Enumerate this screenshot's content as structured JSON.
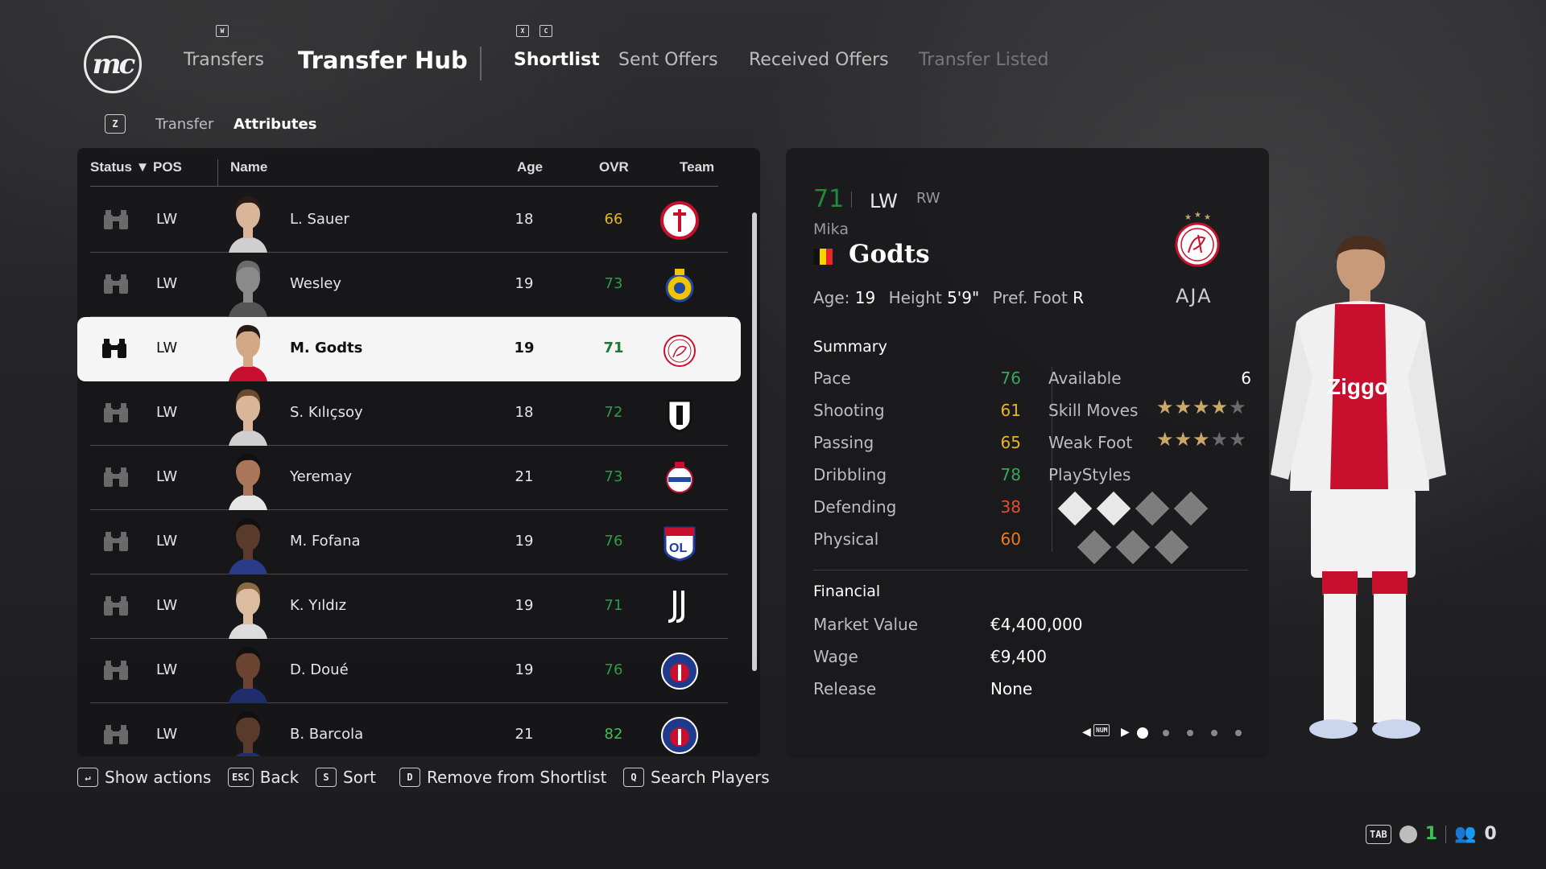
{
  "header": {
    "logo_text": "mc",
    "key_w": "W",
    "key_x": "X",
    "key_c": "C",
    "nav_transfers": "Transfers",
    "title": "Transfer Hub",
    "tabs": [
      "Shortlist",
      "Sent Offers",
      "Received Offers",
      "Transfer Listed"
    ],
    "active_tab": "Shortlist"
  },
  "subtabs": {
    "key": "Z",
    "items": [
      "Transfer",
      "Attributes"
    ],
    "active": "Attributes"
  },
  "table": {
    "columns": {
      "status": "Status ▼",
      "pos": "POS",
      "name": "Name",
      "age": "Age",
      "ovr": "OVR",
      "team": "Team"
    },
    "rows": [
      {
        "pos": "LW",
        "name": "L. Sauer",
        "age": "18",
        "ovr": "66",
        "ovr_color": "#e8b420",
        "team": "feyenoord-badge"
      },
      {
        "pos": "LW",
        "name": "Wesley",
        "age": "19",
        "ovr": "73",
        "ovr_color": "#2e9a4a",
        "team": "al-nassr-badge"
      },
      {
        "pos": "LW",
        "name": "M. Godts",
        "age": "19",
        "ovr": "71",
        "ovr_color": "#1f8a3a",
        "team": "ajax-badge",
        "selected": true
      },
      {
        "pos": "LW",
        "name": "S. Kılıçsoy",
        "age": "18",
        "ovr": "72",
        "ovr_color": "#2e9a4a",
        "team": "besiktas-badge"
      },
      {
        "pos": "LW",
        "name": "Yeremay",
        "age": "21",
        "ovr": "73",
        "ovr_color": "#2e9a4a",
        "team": "deportivo-badge"
      },
      {
        "pos": "LW",
        "name": "M. Fofana",
        "age": "19",
        "ovr": "76",
        "ovr_color": "#2e9a4a",
        "team": "lyon-badge"
      },
      {
        "pos": "LW",
        "name": "K. Yıldız",
        "age": "19",
        "ovr": "71",
        "ovr_color": "#2e9a4a",
        "team": "juventus-badge"
      },
      {
        "pos": "LW",
        "name": "D. Doué",
        "age": "19",
        "ovr": "76",
        "ovr_color": "#2e9a4a",
        "team": "psg-badge"
      },
      {
        "pos": "LW",
        "name": "B. Barcola",
        "age": "21",
        "ovr": "82",
        "ovr_color": "#3fbf5a",
        "team": "psg-badge"
      }
    ]
  },
  "player": {
    "ovr": "71",
    "position": "LW",
    "alt_position": "RW",
    "first_name": "Mika",
    "last_name": "Godts",
    "nation": "Belgium",
    "age_label": "Age:",
    "age": "19",
    "height_label": "Height",
    "height": "5'9\"",
    "foot_label": "Pref. Foot",
    "foot": "R",
    "club_abbr": "AJA",
    "summary_title": "Summary",
    "attributes": [
      {
        "label": "Pace",
        "value": "76",
        "color": "#3aa65a"
      },
      {
        "label": "Shooting",
        "value": "61",
        "color": "#e8b420"
      },
      {
        "label": "Passing",
        "value": "65",
        "color": "#e8b420"
      },
      {
        "label": "Dribbling",
        "value": "78",
        "color": "#3aa65a"
      },
      {
        "label": "Defending",
        "value": "38",
        "color": "#e0502e"
      },
      {
        "label": "Physical",
        "value": "60",
        "color": "#f07a20"
      }
    ],
    "available_label": "Available",
    "available": "6",
    "skill_moves_label": "Skill Moves",
    "skill_moves": 4,
    "weak_foot_label": "Weak Foot",
    "weak_foot": 3,
    "playstyles_label": "PlayStyles",
    "financial_title": "Financial",
    "market_value_label": "Market Value",
    "market_value": "€4,400,000",
    "wage_label": "Wage",
    "wage": "€9,400",
    "release_label": "Release",
    "release": "None",
    "pager_key": "NUM"
  },
  "footer": {
    "actions": [
      {
        "key": "↵",
        "label": "Show actions"
      },
      {
        "key": "ESC",
        "label": "Back"
      },
      {
        "key": "S",
        "label": "Sort"
      },
      {
        "key": "D",
        "label": "Remove from Shortlist"
      },
      {
        "key": "Q",
        "label": "Search Players"
      }
    ],
    "tab_key": "TAB",
    "count_a": "1",
    "count_b": "0"
  },
  "colors": {
    "ovr_green": "#2e9a4a",
    "ovr_yellow": "#e8b420",
    "ovr_red": "#e0502e",
    "star_gold": "#c9a86a"
  }
}
